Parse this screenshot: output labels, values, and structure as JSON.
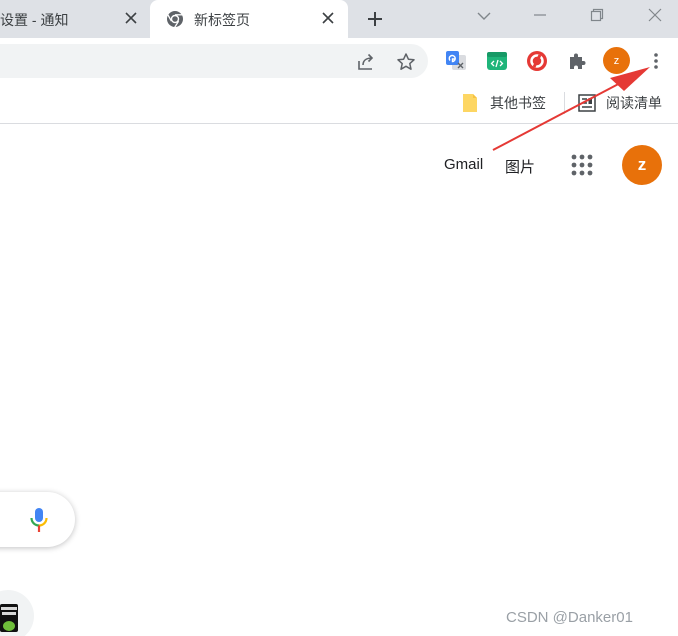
{
  "tabs": [
    {
      "title": "设置 - 通知",
      "active": false
    },
    {
      "title": "新标签页",
      "active": true
    }
  ],
  "tab_icons": {
    "active_favicon": "chrome-logo-icon",
    "close": "close-icon",
    "new_tab": "plus-icon"
  },
  "window_controls": [
    "chevron-down-icon",
    "minimize-icon",
    "restore-icon",
    "close-icon"
  ],
  "toolbar": {
    "omnibox_icons": [
      "share-icon",
      "star-icon"
    ],
    "extensions": [
      "google-translate-icon",
      "code-extension-icon",
      "red-circle-extension-icon",
      "puzzle-icon"
    ],
    "profile_initial": "z",
    "menu_icon": "three-dots-vertical-icon"
  },
  "bookmarks": {
    "other": "其他书签",
    "reading_list": "阅读清单"
  },
  "page": {
    "gmail": "Gmail",
    "images": "图片",
    "avatar_initial": "z"
  },
  "watermark": "CSDN @Danker01",
  "colors": {
    "accent_orange": "#e8710a",
    "annotation_red": "#e53935",
    "tabstrip": "#dee1e6"
  }
}
